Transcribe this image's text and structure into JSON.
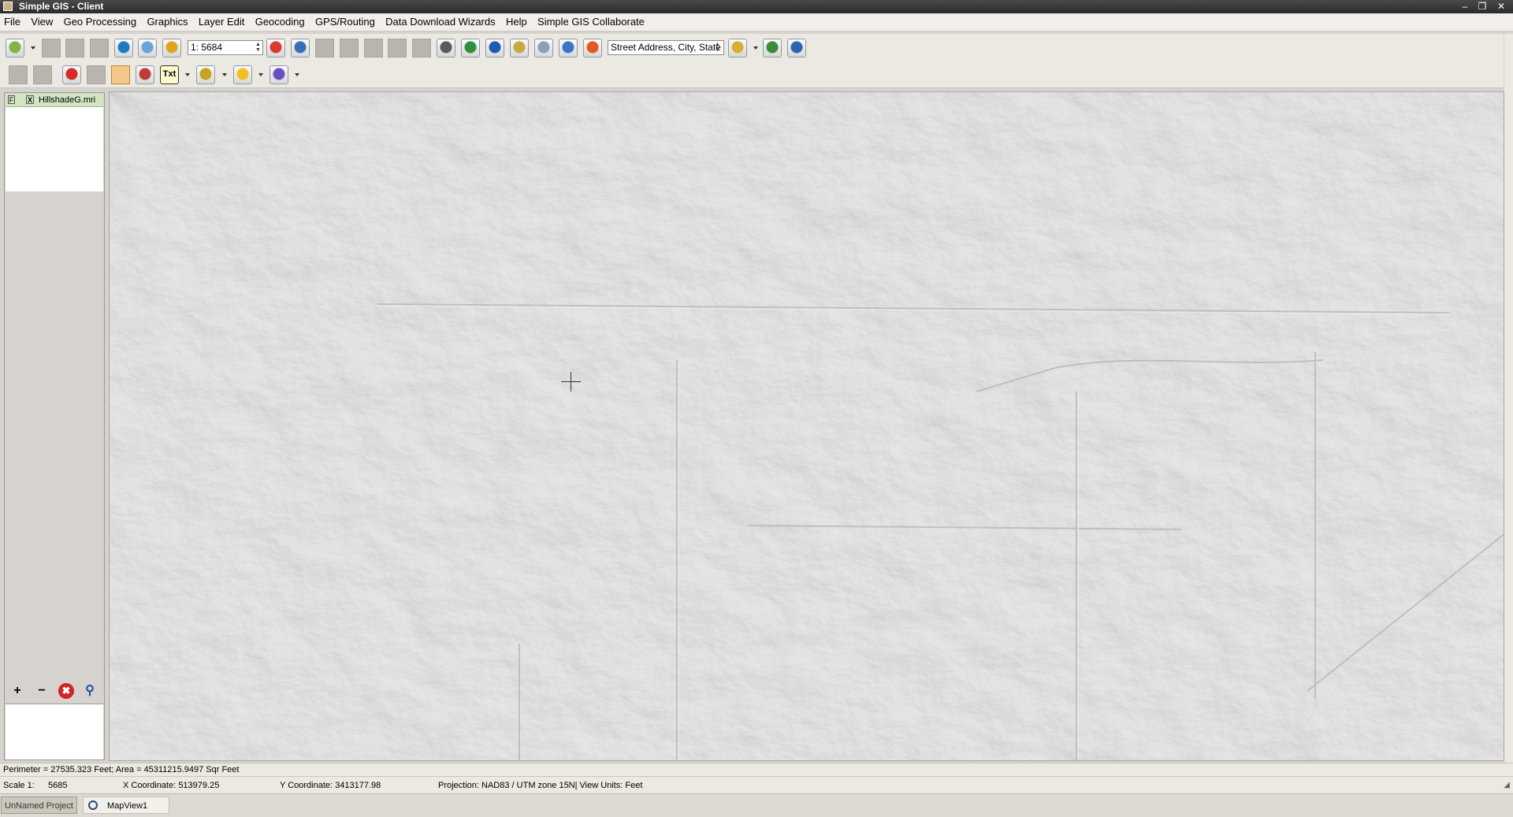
{
  "window": {
    "title": "Simple GIS - Client",
    "minimize_glyph": "–",
    "restore_glyph": "❐",
    "close_glyph": "✕"
  },
  "menu": [
    "File",
    "View",
    "Geo Processing",
    "Graphics",
    "Layer Edit",
    "Geocoding",
    "GPS/Routing",
    "Data Download Wizards",
    "Help",
    "Simple GIS Collaborate"
  ],
  "toolbar": {
    "scale_value": "1: 5684",
    "address_value": "Street Address, City, State",
    "text_tool_label": "Txt",
    "spin_up": "▲",
    "spin_down": "▼"
  },
  "layers": {
    "items": [
      {
        "name": "HillshadeG.mri",
        "flag": "F",
        "visible_mark": "X"
      }
    ],
    "add_label": "+",
    "remove_label": "−",
    "delete_glyph": "✖",
    "zoom_glyph": "⚲"
  },
  "status": {
    "measure": "Perimeter = 27535.323  Feet; Area = 45311215.9497 Sqr  Feet",
    "scale_label": "Scale 1:",
    "scale_value": "5685",
    "x_coord": "X Coordinate:  513979.25",
    "y_coord": "Y Coordinate: 3413177.98",
    "projection": "Projection: NAD83 / UTM zone 15N| View Units: Feet",
    "grip": "◢"
  },
  "taskbar": {
    "project": "UnNamed Project",
    "mapview": "MapView1"
  },
  "colors": {
    "map_bg": "#c9c9c9",
    "layer_selected": "#d4e5c4",
    "tool_active": "#f4c88a"
  }
}
